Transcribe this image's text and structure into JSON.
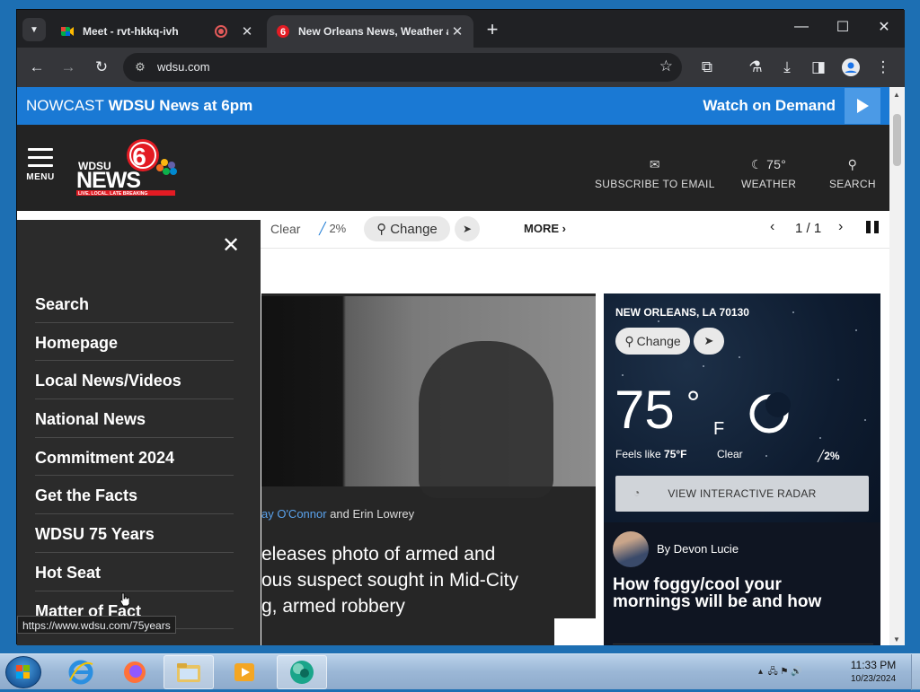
{
  "browser": {
    "tabs": [
      {
        "title": "Meet - rvt-hkkq-ivh",
        "recording": true
      },
      {
        "title": "New Orleans News, Weather and Sports | WDSU",
        "active": true
      }
    ],
    "url": "wdsu.com"
  },
  "site": {
    "nowcast": {
      "prefix": "NOWCAST",
      "label": "WDSU News at 6pm",
      "watch": "Watch on Demand"
    },
    "header": {
      "menu_label": "MENU",
      "logo_word": "WDSU",
      "logo_news": "NEWS",
      "logo_tag": "LIVE. LOCAL. LATE BREAKING",
      "logo_number": "6",
      "subscribe": "SUBSCRIBE TO EMAIL",
      "temp": "75°",
      "weather": "WEATHER",
      "search": "SEARCH"
    },
    "weather_bar": {
      "condition": "Clear",
      "precip": "2%",
      "change": "Change",
      "more": "MORE",
      "pager": "1 / 1"
    },
    "menu": {
      "items": [
        "Search",
        "Homepage",
        "Local News/Videos",
        "National News",
        "Commitment 2024",
        "Get the Facts",
        "WDSU 75 Years",
        "Hot Seat",
        "Matter of Fact"
      ]
    },
    "story": {
      "author1": "ay O'Connor",
      "and": " and Erin Lowrey",
      "headline_lines": [
        "eleases photo of armed and",
        "ous suspect sought in Mid-City",
        "g, armed robbery"
      ]
    },
    "weather_card": {
      "city": "NEW ORLEANS, LA 70130",
      "change": "Change",
      "temp": "75",
      "deg": "°",
      "unit": "F",
      "feels_like_label": "Feels like ",
      "feels_like_value": "75°F",
      "condition": "Clear",
      "precip": "2%",
      "radar": "VIEW INTERACTIVE RADAR",
      "author": "By Devon Lucie",
      "headline_lines": [
        "How foggy/cool your",
        "mornings will be and how"
      ]
    }
  },
  "status_url": "https://www.wdsu.com/75years",
  "taskbar": {
    "time": "11:33 PM",
    "date": "10/23/2024"
  },
  "colors": {
    "accent": "#1a79d4",
    "header_bg": "#232323",
    "menu_bg": "#2b2b2b",
    "logo_red": "#e31b23"
  }
}
